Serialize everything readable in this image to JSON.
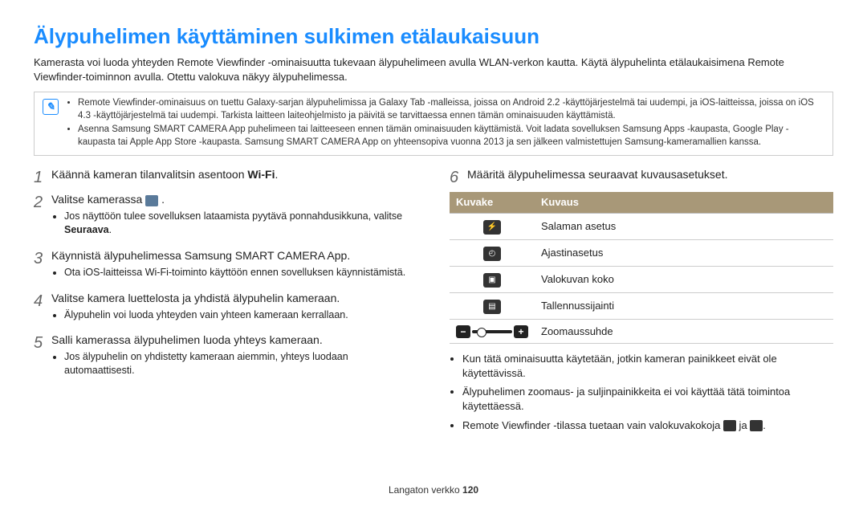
{
  "title": "Älypuhelimen käyttäminen sulkimen etälaukaisuun",
  "intro": "Kamerasta voi luoda yhteyden Remote Viewfinder -ominaisuutta tukevaan älypuhelimeen avulla WLAN-verkon kautta. Käytä älypuhelinta etälaukaisimena Remote Viewfinder-toiminnon avulla. Otettu valokuva näkyy älypuhelimessa.",
  "notebox": {
    "items": [
      "Remote Viewfinder-ominaisuus on tuettu Galaxy-sarjan älypuhelimissa ja Galaxy Tab -malleissa, joissa on Android 2.2 -käyttöjärjestelmä tai uudempi, ja iOS-laitteissa, joissa on iOS 4.3 -käyttöjärjestelmä tai uudempi. Tarkista laitteen laiteohjelmisto ja päivitä se tarvittaessa ennen tämän ominaisuuden käyttämistä.",
      "Asenna Samsung SMART CAMERA App puhelimeen tai laitteeseen ennen tämän ominaisuuden käyttämistä. Voit ladata sovelluksen Samsung Apps -kaupasta, Google Play -kaupasta tai Apple App Store -kaupasta. Samsung SMART CAMERA App on yhteensopiva vuonna 2013 ja sen jälkeen valmistettujen Samsung-kameramallien kanssa."
    ]
  },
  "left": {
    "s1": {
      "text": "Käännä kameran tilanvalitsin asentoon ",
      "wifi": "Wi-Fi",
      "end": "."
    },
    "s2": {
      "text": "Valitse kamerassa ",
      "bullets": [
        "Jos näyttöön tulee sovelluksen lataamista pyytävä ponnahdusikkuna, valitse "
      ],
      "bold": "Seuraava",
      "after": "."
    },
    "s3": {
      "text": "Käynnistä älypuhelimessa Samsung SMART CAMERA App.",
      "bullets": [
        "Ota iOS-laitteissa Wi-Fi-toiminto käyttöön ennen sovelluksen käynnistämistä."
      ]
    },
    "s4": {
      "text": "Valitse kamera luettelosta ja yhdistä älypuhelin kameraan.",
      "bullets": [
        "Älypuhelin voi luoda yhteyden vain yhteen kameraan kerrallaan."
      ]
    },
    "s5": {
      "text": "Salli kamerassa älypuhelimen luoda yhteys kameraan.",
      "bullets": [
        "Jos älypuhelin on yhdistetty kameraan aiemmin, yhteys luodaan automaattisesti."
      ]
    }
  },
  "right": {
    "s6": {
      "text": "Määritä älypuhelimessa seuraavat kuvausasetukset."
    },
    "table": {
      "h1": "Kuvake",
      "h2": "Kuvaus",
      "rows": [
        {
          "icon": "flash-icon",
          "label": "Salaman asetus"
        },
        {
          "icon": "timer-icon",
          "label": "Ajastinasetus"
        },
        {
          "icon": "size-icon",
          "label": "Valokuvan koko"
        },
        {
          "icon": "storage-icon",
          "label": "Tallennussijainti"
        },
        {
          "icon": "zoom-icon",
          "label": "Zoomaussuhde"
        }
      ]
    },
    "bullets": [
      "Kun tätä ominaisuutta käytetään, jotkin kameran painikkeet eivät ole käytettävissä.",
      "Älypuhelimen zoomaus- ja suljinpainikkeita ei voi käyttää tätä toimintoa käytettäessä."
    ],
    "b3_a": "Remote Viewfinder -tilassa tuetaan vain valokuvakokoja ",
    "b3_b": " ja ",
    "b3_c": "."
  },
  "footer": {
    "label": "Langaton verkko  ",
    "page": "120"
  }
}
